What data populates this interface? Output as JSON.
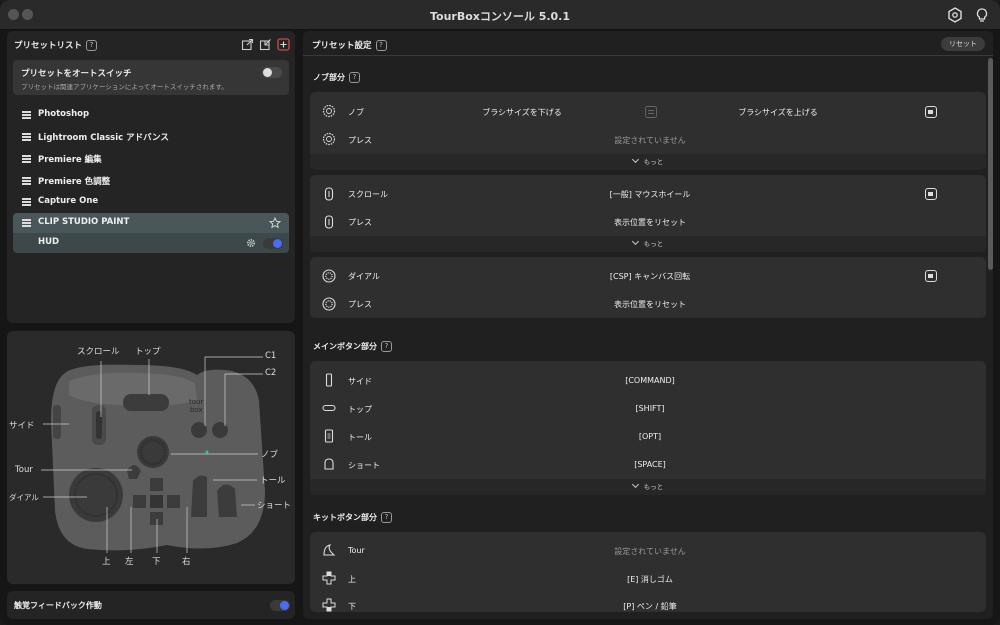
{
  "window": {
    "title": "TourBoxコンソール 5.0.1"
  },
  "left": {
    "preset_list_title": "プリセットリスト",
    "auto_switch": {
      "title": "プリセットをオートスイッチ",
      "desc": "プリセットは関連アプリケーションによってオートスイッチされます。"
    },
    "presets": [
      {
        "name": "Photoshop"
      },
      {
        "name": "Lightroom Classic アドバンス"
      },
      {
        "name": "Premiere 編集"
      },
      {
        "name": "Premiere 色調整"
      },
      {
        "name": "Capture One"
      },
      {
        "name": "CLIP STUDIO PAINT"
      }
    ],
    "hud": {
      "label": "HUD"
    },
    "device_labels": {
      "scroll": "スクロール",
      "top": "トップ",
      "c1": "C1",
      "c2": "C2",
      "side": "サイド",
      "knob": "ノブ",
      "tour": "Tour",
      "tall": "トール",
      "dial": "ダイアル",
      "short": "ショート",
      "up": "上",
      "left": "左",
      "down": "下",
      "right": "右"
    },
    "haptic": "触覚フィードバック作動"
  },
  "right": {
    "title": "プリセット設定",
    "reset": "リセット",
    "knob_section": "ノブ部分",
    "main_section": "メインボタン部分",
    "kit_section": "キットボタン部分",
    "more": "もっと",
    "knob_card": {
      "name": "ノブ",
      "left": "ブラシサイズを下げる",
      "right": "ブラシサイズを上げる",
      "press": "プレス",
      "press_value": "設定されていません"
    },
    "scroll_card": {
      "name": "スクロール",
      "value": "[一般] マウスホイール",
      "press": "プレス",
      "press_value": "表示位置をリセット"
    },
    "dial_card": {
      "name": "ダイアル",
      "value": "[CSP] キャンバス回転",
      "press": "プレス",
      "press_value": "表示位置をリセット"
    },
    "main_rows": [
      {
        "name": "サイド",
        "value": "[COMMAND]"
      },
      {
        "name": "トップ",
        "value": "[SHIFT]"
      },
      {
        "name": "トール",
        "value": "[OPT]"
      },
      {
        "name": "ショート",
        "value": "[SPACE]"
      }
    ],
    "kit_rows": [
      {
        "name": "Tour",
        "value": "設定されていません"
      },
      {
        "name": "上",
        "value": "[E] 消しゴム"
      },
      {
        "name": "下",
        "value": "[P] ペン / 鉛筆"
      }
    ]
  }
}
